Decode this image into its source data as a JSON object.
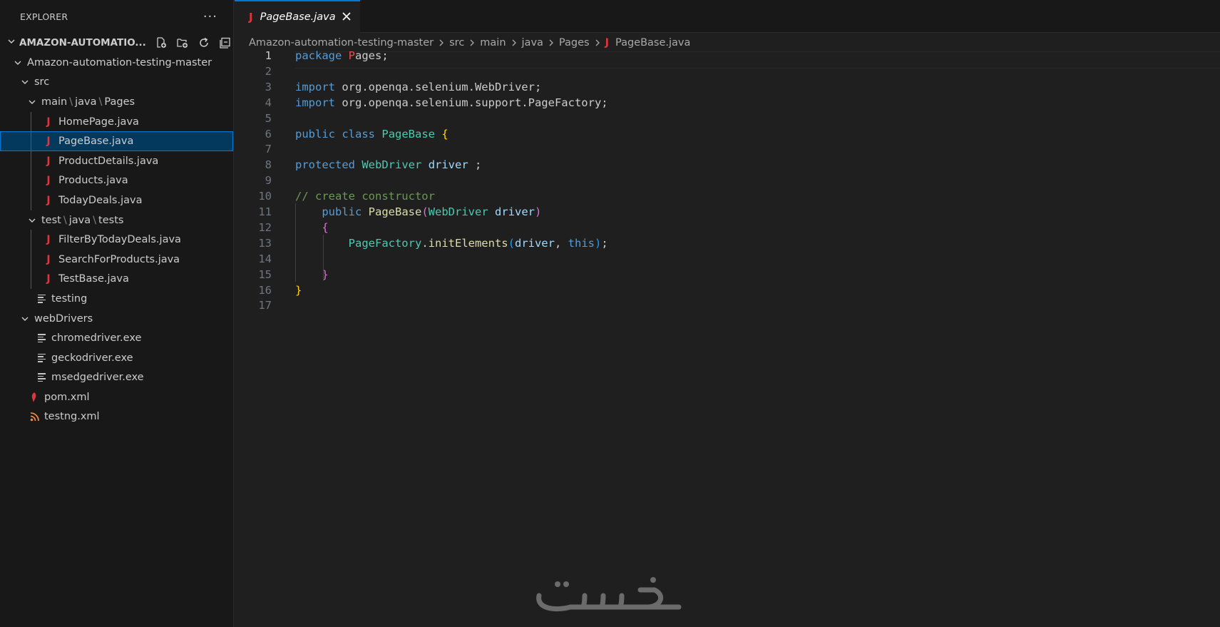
{
  "sidebar": {
    "title": "EXPLORER",
    "more": "···",
    "workspace": "AMAZON-AUTOMATIO...",
    "actions": [
      "new-file-icon",
      "new-folder-icon",
      "refresh-icon",
      "collapse-all-icon"
    ],
    "tree": [
      {
        "label": "Amazon-automation-testing-master",
        "level": 0,
        "kind": "folder-open"
      },
      {
        "label": "src",
        "level": 1,
        "kind": "folder-open"
      },
      {
        "label": "main\\java\\Pages",
        "level": 2,
        "kind": "folder-open"
      },
      {
        "label": "HomePage.java",
        "level": 3,
        "kind": "java"
      },
      {
        "label": "PageBase.java",
        "level": 3,
        "kind": "java",
        "selected": true
      },
      {
        "label": "ProductDetails.java",
        "level": 3,
        "kind": "java"
      },
      {
        "label": "Products.java",
        "level": 3,
        "kind": "java"
      },
      {
        "label": "TodayDeals.java",
        "level": 3,
        "kind": "java"
      },
      {
        "label": "test\\java\\tests",
        "level": 2,
        "kind": "folder-open"
      },
      {
        "label": "FilterByTodayDeals.java",
        "level": 3,
        "kind": "java"
      },
      {
        "label": "SearchForProducts.java",
        "level": 3,
        "kind": "java"
      },
      {
        "label": "TestBase.java",
        "level": 3,
        "kind": "java"
      },
      {
        "label": "testing",
        "level": 2,
        "kind": "text"
      },
      {
        "label": "webDrivers",
        "level": 1,
        "kind": "folder-open"
      },
      {
        "label": "chromedriver.exe",
        "level": 2,
        "kind": "text"
      },
      {
        "label": "geckodriver.exe",
        "level": 2,
        "kind": "text"
      },
      {
        "label": "msedgedriver.exe",
        "level": 2,
        "kind": "text"
      },
      {
        "label": "pom.xml",
        "level": 1,
        "kind": "maven"
      },
      {
        "label": "testng.xml",
        "level": 1,
        "kind": "rss"
      }
    ]
  },
  "tab": {
    "label": "PageBase.java"
  },
  "breadcrumb": [
    "Amazon-automation-testing-master",
    "src",
    "main",
    "java",
    "Pages",
    "PageBase.java"
  ],
  "editor": {
    "active_line": 1,
    "lines": [
      [
        [
          "kw",
          "package"
        ],
        [
          "p",
          " "
        ],
        [
          "red",
          "P"
        ],
        [
          "p",
          "ages;"
        ]
      ],
      [],
      [
        [
          "kw",
          "import"
        ],
        [
          "p",
          " org.openqa.selenium.WebDriver;"
        ]
      ],
      [
        [
          "kw",
          "import"
        ],
        [
          "p",
          " org.openqa.selenium.support.PageFactory;"
        ]
      ],
      [],
      [
        [
          "kw",
          "public"
        ],
        [
          "p",
          " "
        ],
        [
          "kw",
          "class"
        ],
        [
          "p",
          " "
        ],
        [
          "type",
          "PageBase"
        ],
        [
          "p",
          " "
        ],
        [
          "b1",
          "{"
        ]
      ],
      [],
      [
        [
          "kw",
          "protected"
        ],
        [
          "p",
          " "
        ],
        [
          "type",
          "WebDriver"
        ],
        [
          "p",
          " "
        ],
        [
          "var",
          "driver"
        ],
        [
          "p",
          " ;"
        ]
      ],
      [],
      [
        [
          "cmt",
          "// create constructor"
        ]
      ],
      [
        [
          "p",
          "    "
        ],
        [
          "kw",
          "public"
        ],
        [
          "p",
          " "
        ],
        [
          "fn",
          "PageBase"
        ],
        [
          "b2",
          "("
        ],
        [
          "type",
          "WebDriver"
        ],
        [
          "p",
          " "
        ],
        [
          "var",
          "driver"
        ],
        [
          "b2",
          ")"
        ]
      ],
      [
        [
          "p",
          "    "
        ],
        [
          "b2",
          "{"
        ]
      ],
      [
        [
          "p",
          "        "
        ],
        [
          "type",
          "PageFactory"
        ],
        [
          "p",
          "."
        ],
        [
          "fn",
          "initElements"
        ],
        [
          "b3",
          "("
        ],
        [
          "var",
          "driver"
        ],
        [
          "p",
          ", "
        ],
        [
          "kw",
          "this"
        ],
        [
          "b3",
          ")"
        ],
        [
          "p",
          ";"
        ]
      ],
      [],
      [
        [
          "p",
          "    "
        ],
        [
          "b2",
          "}"
        ]
      ],
      [
        [
          "b1",
          "}"
        ]
      ],
      []
    ]
  },
  "colors": {
    "accent": "#0078d4",
    "java_icon": "#e0353c",
    "keyword": "#569cd6",
    "type": "#4ec9b0",
    "function": "#dcdcaa",
    "variable": "#9cdcfe",
    "comment": "#6a9955"
  }
}
